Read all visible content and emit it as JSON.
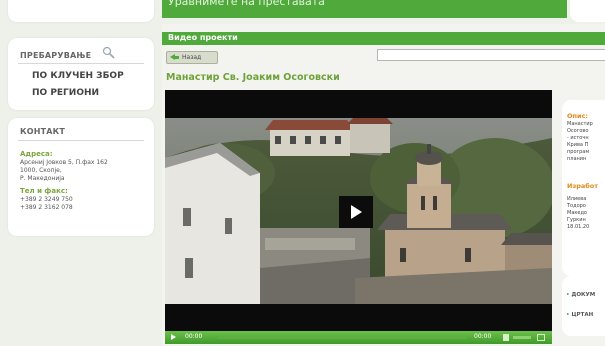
{
  "banner": {
    "text": "Уравнимете на преставата"
  },
  "search_box": {
    "heading": "ПРЕБАРУВАЊЕ",
    "links": [
      "ПО КЛУЧЕН ЗБОР",
      "ПО РЕГИОНИ"
    ]
  },
  "contact": {
    "heading": "КОНТАКТ",
    "address_label": "Адреса:",
    "address_lines": [
      "Арсениј Јовков 5, П.фах 162",
      "1000, Скопје,",
      "Р. Македонија"
    ],
    "phone_label": "Тел и факс:",
    "phone_lines": [
      "+389 2 3249 750",
      "+389 2 3162 078"
    ]
  },
  "main": {
    "section_title": "Видео проекти",
    "back_label": "Назад",
    "video_title": "Манастир Св. Јоаким Осоговски"
  },
  "player": {
    "time_current": "00:00",
    "time_total": "00:00",
    "progress": 0.0
  },
  "info": {
    "description_label": "Опис:",
    "description_lines": [
      "Манастир",
      "Осогово",
      "- источн",
      "Крива П",
      "програм",
      "планин"
    ],
    "made_by_label": "Изработ",
    "made_by_lines": [
      "Илиева",
      "Тодоро",
      "Македо",
      "Гуркин",
      "18.01.20"
    ]
  },
  "docs": {
    "links": [
      "ДОКУМ",
      "ЦРТАН"
    ]
  },
  "colors": {
    "accent_green": "#4fa93b",
    "title_green": "#6ea23a",
    "info_orange": "#e08a17"
  }
}
